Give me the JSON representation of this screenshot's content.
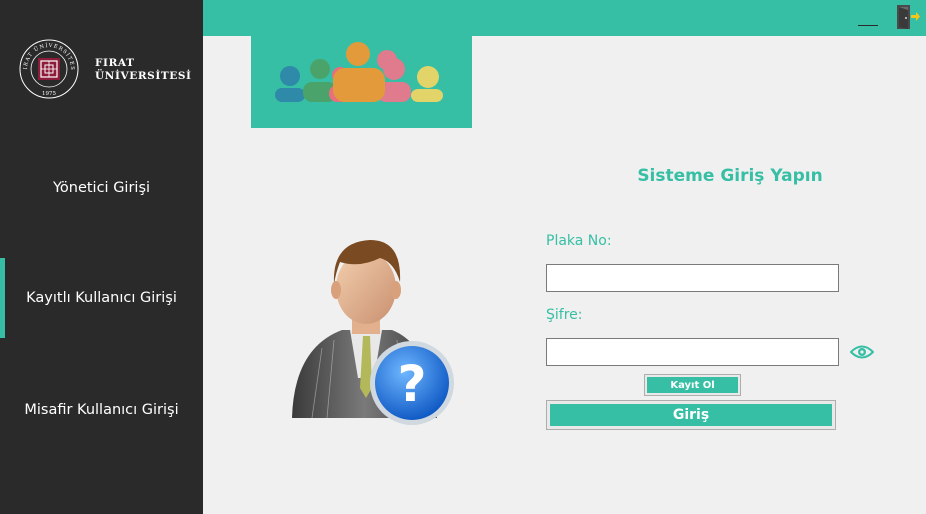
{
  "brand": {
    "line1": "FIRAT",
    "line2": "ÜNİVERSİTESİ",
    "seal_ring_text": "FIRAT ÜNİVERSİTESİ",
    "seal_year": "1975"
  },
  "sidebar": {
    "items": [
      {
        "label": "Yönetici Girişi",
        "active": false
      },
      {
        "label": "Kayıtlı Kullanıcı Girişi",
        "active": true
      },
      {
        "label": "Misafir Kullanıcı Girişi",
        "active": false
      }
    ]
  },
  "window": {
    "minimize_icon": "minimize-icon",
    "exit_icon": "exit-door-icon"
  },
  "form": {
    "title": "Sisteme Giriş Yapın",
    "plate_label": "Plaka No:",
    "plate_value": "",
    "password_label": "Şifre:",
    "password_value": "",
    "show_password_icon": "eye-icon",
    "register_button": "Kayıt Ol",
    "login_button": "Giriş"
  },
  "colors": {
    "accent": "#36bfa5",
    "sidebar": "#2a2a2a",
    "background": "#f0f0f0"
  }
}
